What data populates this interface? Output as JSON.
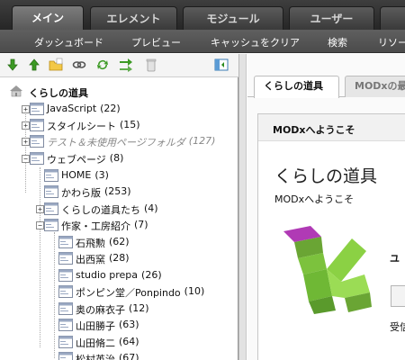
{
  "top_tabs": [
    "メイン",
    "エレメント",
    "モジュール",
    "ユーザー",
    ""
  ],
  "sub_menu": [
    "ダッシュボード",
    "プレビュー",
    "キャッシュをクリア",
    "検索",
    "リソー"
  ],
  "tree": {
    "root": "くらしの道具",
    "nodes": [
      {
        "label": "JavaScript",
        "count": "(22)"
      },
      {
        "label": "スタイルシート",
        "count": "(15)"
      },
      {
        "label": "テスト＆未使用ページフォルダ",
        "count": "(127)"
      },
      {
        "label": "ウェブページ",
        "count": "(8)"
      },
      {
        "label": "HOME",
        "count": "(3)"
      },
      {
        "label": "かわら版",
        "count": "(253)"
      },
      {
        "label": "くらしの道具たち",
        "count": "(4)"
      },
      {
        "label": "作家・工房紹介",
        "count": "(7)"
      },
      {
        "label": "石飛勲",
        "count": "(62)"
      },
      {
        "label": "出西窯",
        "count": "(28)"
      },
      {
        "label": "studio prepa",
        "count": "(26)"
      },
      {
        "label": "ポンピン堂／Ponpindo",
        "count": "(10)"
      },
      {
        "label": "奥の麻衣子",
        "count": "(12)"
      },
      {
        "label": "山田勝子",
        "count": "(63)"
      },
      {
        "label": "山田脩二",
        "count": "(64)"
      },
      {
        "label": "松村英治",
        "count": "(67)"
      }
    ]
  },
  "right": {
    "tab_active": "くらしの道具",
    "tab_inactive": "MODxの最",
    "card_title": "MODxへようこそ",
    "welcome_title": "くらしの道具",
    "welcome_sub": "MODxへようこそ",
    "cut_text_1": "ユ",
    "cut_text_2": "受信"
  }
}
